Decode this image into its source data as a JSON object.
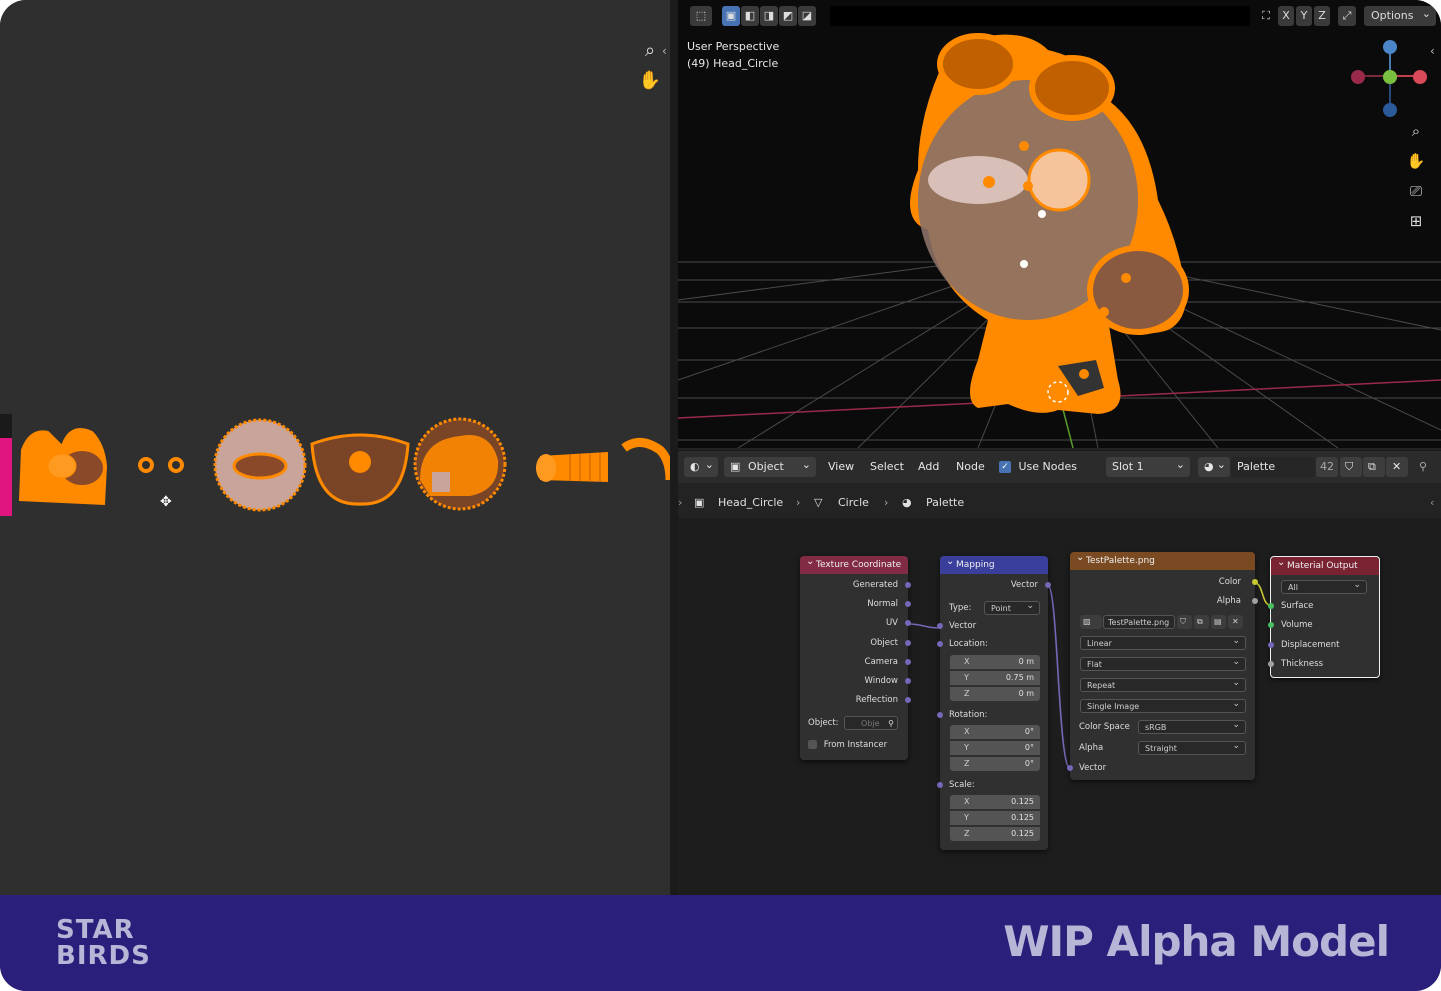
{
  "viewport": {
    "options_label": "Options",
    "axis_x": "X",
    "axis_y": "Y",
    "axis_z": "Z",
    "perspective": "User Perspective",
    "object_info": "(49) Head_Circle"
  },
  "node_header": {
    "mode": "Object",
    "menu": [
      "View",
      "Select",
      "Add",
      "Node"
    ],
    "use_nodes": "Use Nodes",
    "slot": "Slot 1",
    "material": "Palette",
    "users": "42"
  },
  "breadcrumb": {
    "object": "Head_Circle",
    "mesh": "Circle",
    "material": "Palette"
  },
  "nodes": {
    "texture_coordinate": {
      "title": "Texture Coordinate",
      "outputs": [
        "Generated",
        "Normal",
        "UV",
        "Object",
        "Camera",
        "Window",
        "Reflection"
      ],
      "object_label": "Object:",
      "object_placeholder": "Obje",
      "from_instancer": "From Instancer"
    },
    "mapping": {
      "title": "Mapping",
      "output": "Vector",
      "type_label": "Type:",
      "type_value": "Point",
      "vector_label": "Vector",
      "location_label": "Location:",
      "location": [
        {
          "axis": "X",
          "value": "0 m"
        },
        {
          "axis": "Y",
          "value": "0.75 m"
        },
        {
          "axis": "Z",
          "value": "0 m"
        }
      ],
      "rotation_label": "Rotation:",
      "rotation": [
        {
          "axis": "X",
          "value": "0°"
        },
        {
          "axis": "Y",
          "value": "0°"
        },
        {
          "axis": "Z",
          "value": "0°"
        }
      ],
      "scale_label": "Scale:",
      "scale": [
        {
          "axis": "X",
          "value": "0.125"
        },
        {
          "axis": "Y",
          "value": "0.125"
        },
        {
          "axis": "Z",
          "value": "0.125"
        }
      ]
    },
    "image_texture": {
      "title": "TestPalette.png",
      "outputs": [
        "Color",
        "Alpha"
      ],
      "image_name": "TestPalette.png",
      "interpolation": "Linear",
      "projection": "Flat",
      "extension": "Repeat",
      "source": "Single Image",
      "color_space_label": "Color Space",
      "color_space": "sRGB",
      "alpha_label": "Alpha",
      "alpha_mode": "Straight",
      "vector_input": "Vector"
    },
    "material_output": {
      "title": "Material Output",
      "target": "All",
      "inputs": [
        "Surface",
        "Volume",
        "Displacement",
        "Thickness"
      ]
    }
  },
  "banner": {
    "logo_line1": "STAR",
    "logo_line2": "BIRDS",
    "title": "WIP Alpha Model"
  },
  "colors": {
    "selection_orange": "#ff8a00",
    "banner_bg": "#2a1f7a",
    "banner_text": "#b6b6d6",
    "tex_coord_header": "#822b45",
    "mapping_header": "#3b3f9c",
    "image_header": "#7a4a22",
    "output_header": "#7a2333"
  }
}
